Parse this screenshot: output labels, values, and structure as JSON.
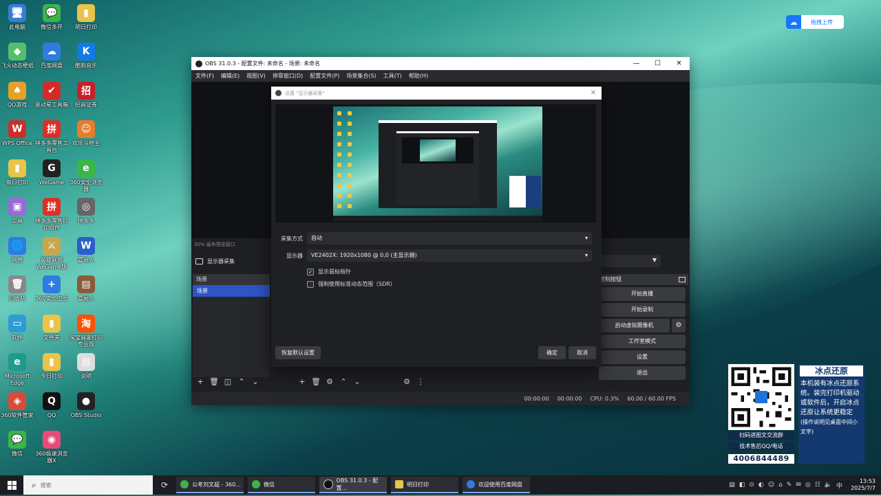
{
  "desktop": {
    "icons": [
      {
        "label": "此电脑",
        "glyph": "🖥",
        "color": "#3a7bd5"
      },
      {
        "label": "微信多开",
        "glyph": "💬",
        "color": "#3bb54a"
      },
      {
        "label": "明日打印",
        "glyph": "▮",
        "color": "#e8c44a"
      },
      {
        "label": "飞火动态壁纸",
        "glyph": "◆",
        "color": "#52c06a"
      },
      {
        "label": "百度网盘",
        "glyph": "☁",
        "color": "#2f7be0"
      },
      {
        "label": "酷狗音乐",
        "glyph": "K",
        "color": "#1479e6"
      },
      {
        "label": "QQ游戏",
        "glyph": "♠",
        "color": "#e6a027"
      },
      {
        "label": "驱动星工具箱",
        "glyph": "✔",
        "color": "#d42a2a"
      },
      {
        "label": "招商证券",
        "glyph": "招",
        "color": "#c8202a"
      },
      {
        "label": "WPS Office",
        "glyph": "W",
        "color": "#c9302c"
      },
      {
        "label": "拼多多零售工具台",
        "glyph": "拼",
        "color": "#e02e24"
      },
      {
        "label": "欢乐斗地主",
        "glyph": "☺",
        "color": "#e87b2d"
      },
      {
        "label": "每日打印",
        "glyph": "▮",
        "color": "#e8c44a"
      },
      {
        "label": "WeGame",
        "glyph": "G",
        "color": "#222"
      },
      {
        "label": "360安全浏览器",
        "glyph": "e",
        "color": "#3bb54a"
      },
      {
        "label": "工具",
        "glyph": "▣",
        "color": "#9a6ad6"
      },
      {
        "label": "拼多多零售打印组件",
        "glyph": "拼",
        "color": "#e02e24"
      },
      {
        "label": "拼多多",
        "glyph": "◎",
        "color": "#666"
      },
      {
        "label": "网络",
        "glyph": "🌐",
        "color": "#2f7be0"
      },
      {
        "label": "英雄联盟WeGame版",
        "glyph": "⚔",
        "color": "#c9a64a"
      },
      {
        "label": "嘉易人",
        "glyph": "W",
        "color": "#2a5fcc"
      },
      {
        "label": "回收站",
        "glyph": "🗑",
        "color": "#888"
      },
      {
        "label": "360安全卫士",
        "glyph": "+",
        "color": "#2f7be0"
      },
      {
        "label": "嘉易人",
        "glyph": "▤",
        "color": "#8a5a3a"
      },
      {
        "label": "软件",
        "glyph": "▭",
        "color": "#2f9bd6"
      },
      {
        "label": "文件夹",
        "glyph": "▮",
        "color": "#e8c44a"
      },
      {
        "label": "淘宝商家打印专业版",
        "glyph": "淘",
        "color": "#ff5000"
      },
      {
        "label": "Microsoft Edge",
        "glyph": "e",
        "color": "#1e9b8a"
      },
      {
        "label": "今日打印",
        "glyph": "▮",
        "color": "#e8c44a"
      },
      {
        "label": "说明",
        "glyph": "▤",
        "color": "#ddd"
      },
      {
        "label": "360软件管家",
        "glyph": "◈",
        "color": "#d94a3a"
      },
      {
        "label": "QQ",
        "glyph": "Q",
        "color": "#111"
      },
      {
        "label": "OBS Studio",
        "glyph": "●",
        "color": "#222"
      },
      {
        "label": "微信",
        "glyph": "💬",
        "color": "#3bb54a"
      },
      {
        "label": "360极速浏览器X",
        "glyph": "◉",
        "color": "#e84a7a"
      }
    ]
  },
  "baidu_upload": {
    "label": "拖拽上传",
    "icon": "cloud-icon"
  },
  "obs": {
    "title": "OBS 31.0.3 - 配置文件: 未命名 - 场景: 未命名",
    "window_controls": [
      "—",
      "☐",
      "✕"
    ],
    "menu": [
      "文件(F)",
      "编辑(E)",
      "视图(V)",
      "停靠窗口(D)",
      "配置文件(P)",
      "场景集合(S)",
      "工具(T)",
      "帮助(H)"
    ],
    "preview_bar": "30%  画布预览窗口",
    "source_label": "显示器采集",
    "scenes_header": "场景",
    "scene_item": "场景",
    "controls_header": "控制按钮",
    "controls": {
      "stream": "开始直播",
      "record": "开始录制",
      "virtualcam": "启动虚拟摄像机",
      "studio": "工作室模式",
      "settings": "设置",
      "exit": "退出"
    },
    "status": {
      "t1": "00:00:00",
      "t2": "00:00:00",
      "cpu": "CPU: 0.3%",
      "fps": "60.00 / 60.00 FPS"
    }
  },
  "dialog": {
    "title": "设置 \"显示器采集\"",
    "capture_method_label": "采集方式",
    "capture_method_value": "自动",
    "display_label": "显示器",
    "display_value": "VE2402X: 1920x1080 @ 0,0 (主显示器)",
    "show_cursor": "显示鼠标指针",
    "force_sdr": "强制使用标准动态范围（SDR）",
    "defaults_button": "恢复默认设置",
    "ok_button": "确定",
    "cancel_button": "取消"
  },
  "ad": {
    "qr_caption": "扫码进图文交流群",
    "support": "技术售后QQ/电话",
    "phone": "4006844489",
    "brand": "冰点还原",
    "body": "本机装有冰点还原系统。装完打印机驱动或软件后，开启冰点还原让系统更稳定",
    "note": "(操作说明见桌面中间小文字)"
  },
  "taskbar": {
    "search_placeholder": "搜索",
    "apps": [
      {
        "label": "公考刘文超 - 360...",
        "color": "#3bb54a"
      },
      {
        "label": "微信",
        "color": "#3bb54a"
      },
      {
        "label": "OBS 31.0.3 - 配置...",
        "color": "#222"
      },
      {
        "label": "明日打印",
        "color": "#e8c44a"
      },
      {
        "label": "欢迎使用百度网盘",
        "color": "#2f7be0"
      }
    ],
    "time": "13:53",
    "date": "2025/7/7"
  }
}
